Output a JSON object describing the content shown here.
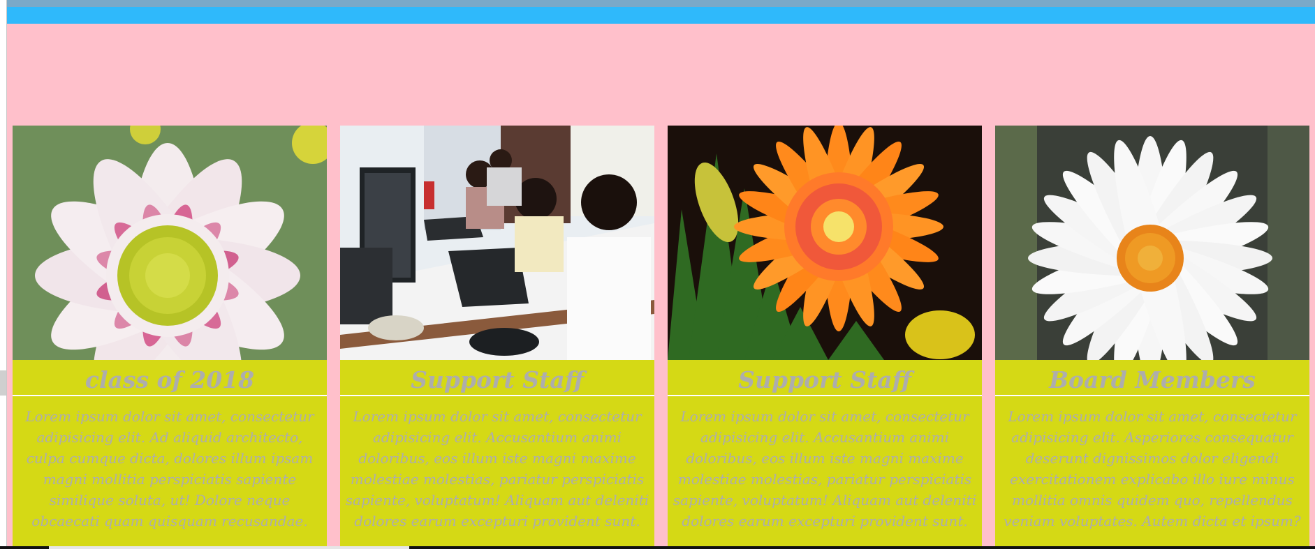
{
  "window": {
    "accent_top": "#7aa9c8",
    "accent_bar": "#2fb9fb",
    "background": "#ffc0cb"
  },
  "cards": [
    {
      "image": "pink-white-flower-photo",
      "title": "class of 2018",
      "body": "Lorem ipsum dolor sit amet, consectetur adipisicing elit. Ad aliquid architecto, culpa cumque dicta, dolores illum ipsam magni mollitia perspiciatis sapiente similique soluta, ut! Dolore neque obcaecati quam quisquam recusandae."
    },
    {
      "image": "children-at-computers-photo",
      "title": "Support Staff",
      "body": "Lorem ipsum dolor sit amet, consectetur adipisicing elit. Accusantium animi doloribus, eos illum iste magni maxime molestiae molestias, pariatur perspiciatis sapiente, voluptatum! Aliquam aut deleniti dolores earum excepturi provident sunt."
    },
    {
      "image": "orange-gerbera-photo",
      "title": "Support Staff",
      "body": "Lorem ipsum dolor sit amet, consectetur adipisicing elit. Accusantium animi doloribus, eos illum iste magni maxime molestiae molestias, pariatur perspiciatis sapiente, voluptatum! Aliquam aut deleniti dolores earum excepturi provident sunt."
    },
    {
      "image": "white-daisy-photo",
      "title": "Board Members",
      "body": "Lorem ipsum dolor sit amet, consectetur adipisicing elit. Asperiores consequatur deserunt dignissimos dolor eligendi exercitationem explicabo illo iure minus mollitia omnis quidem quo, repellendus veniam voluptates. Autem dicta et ipsum?"
    }
  ],
  "colors": {
    "card": "#d5d915",
    "card_text": "#adadad",
    "divider": "#ffffff"
  }
}
